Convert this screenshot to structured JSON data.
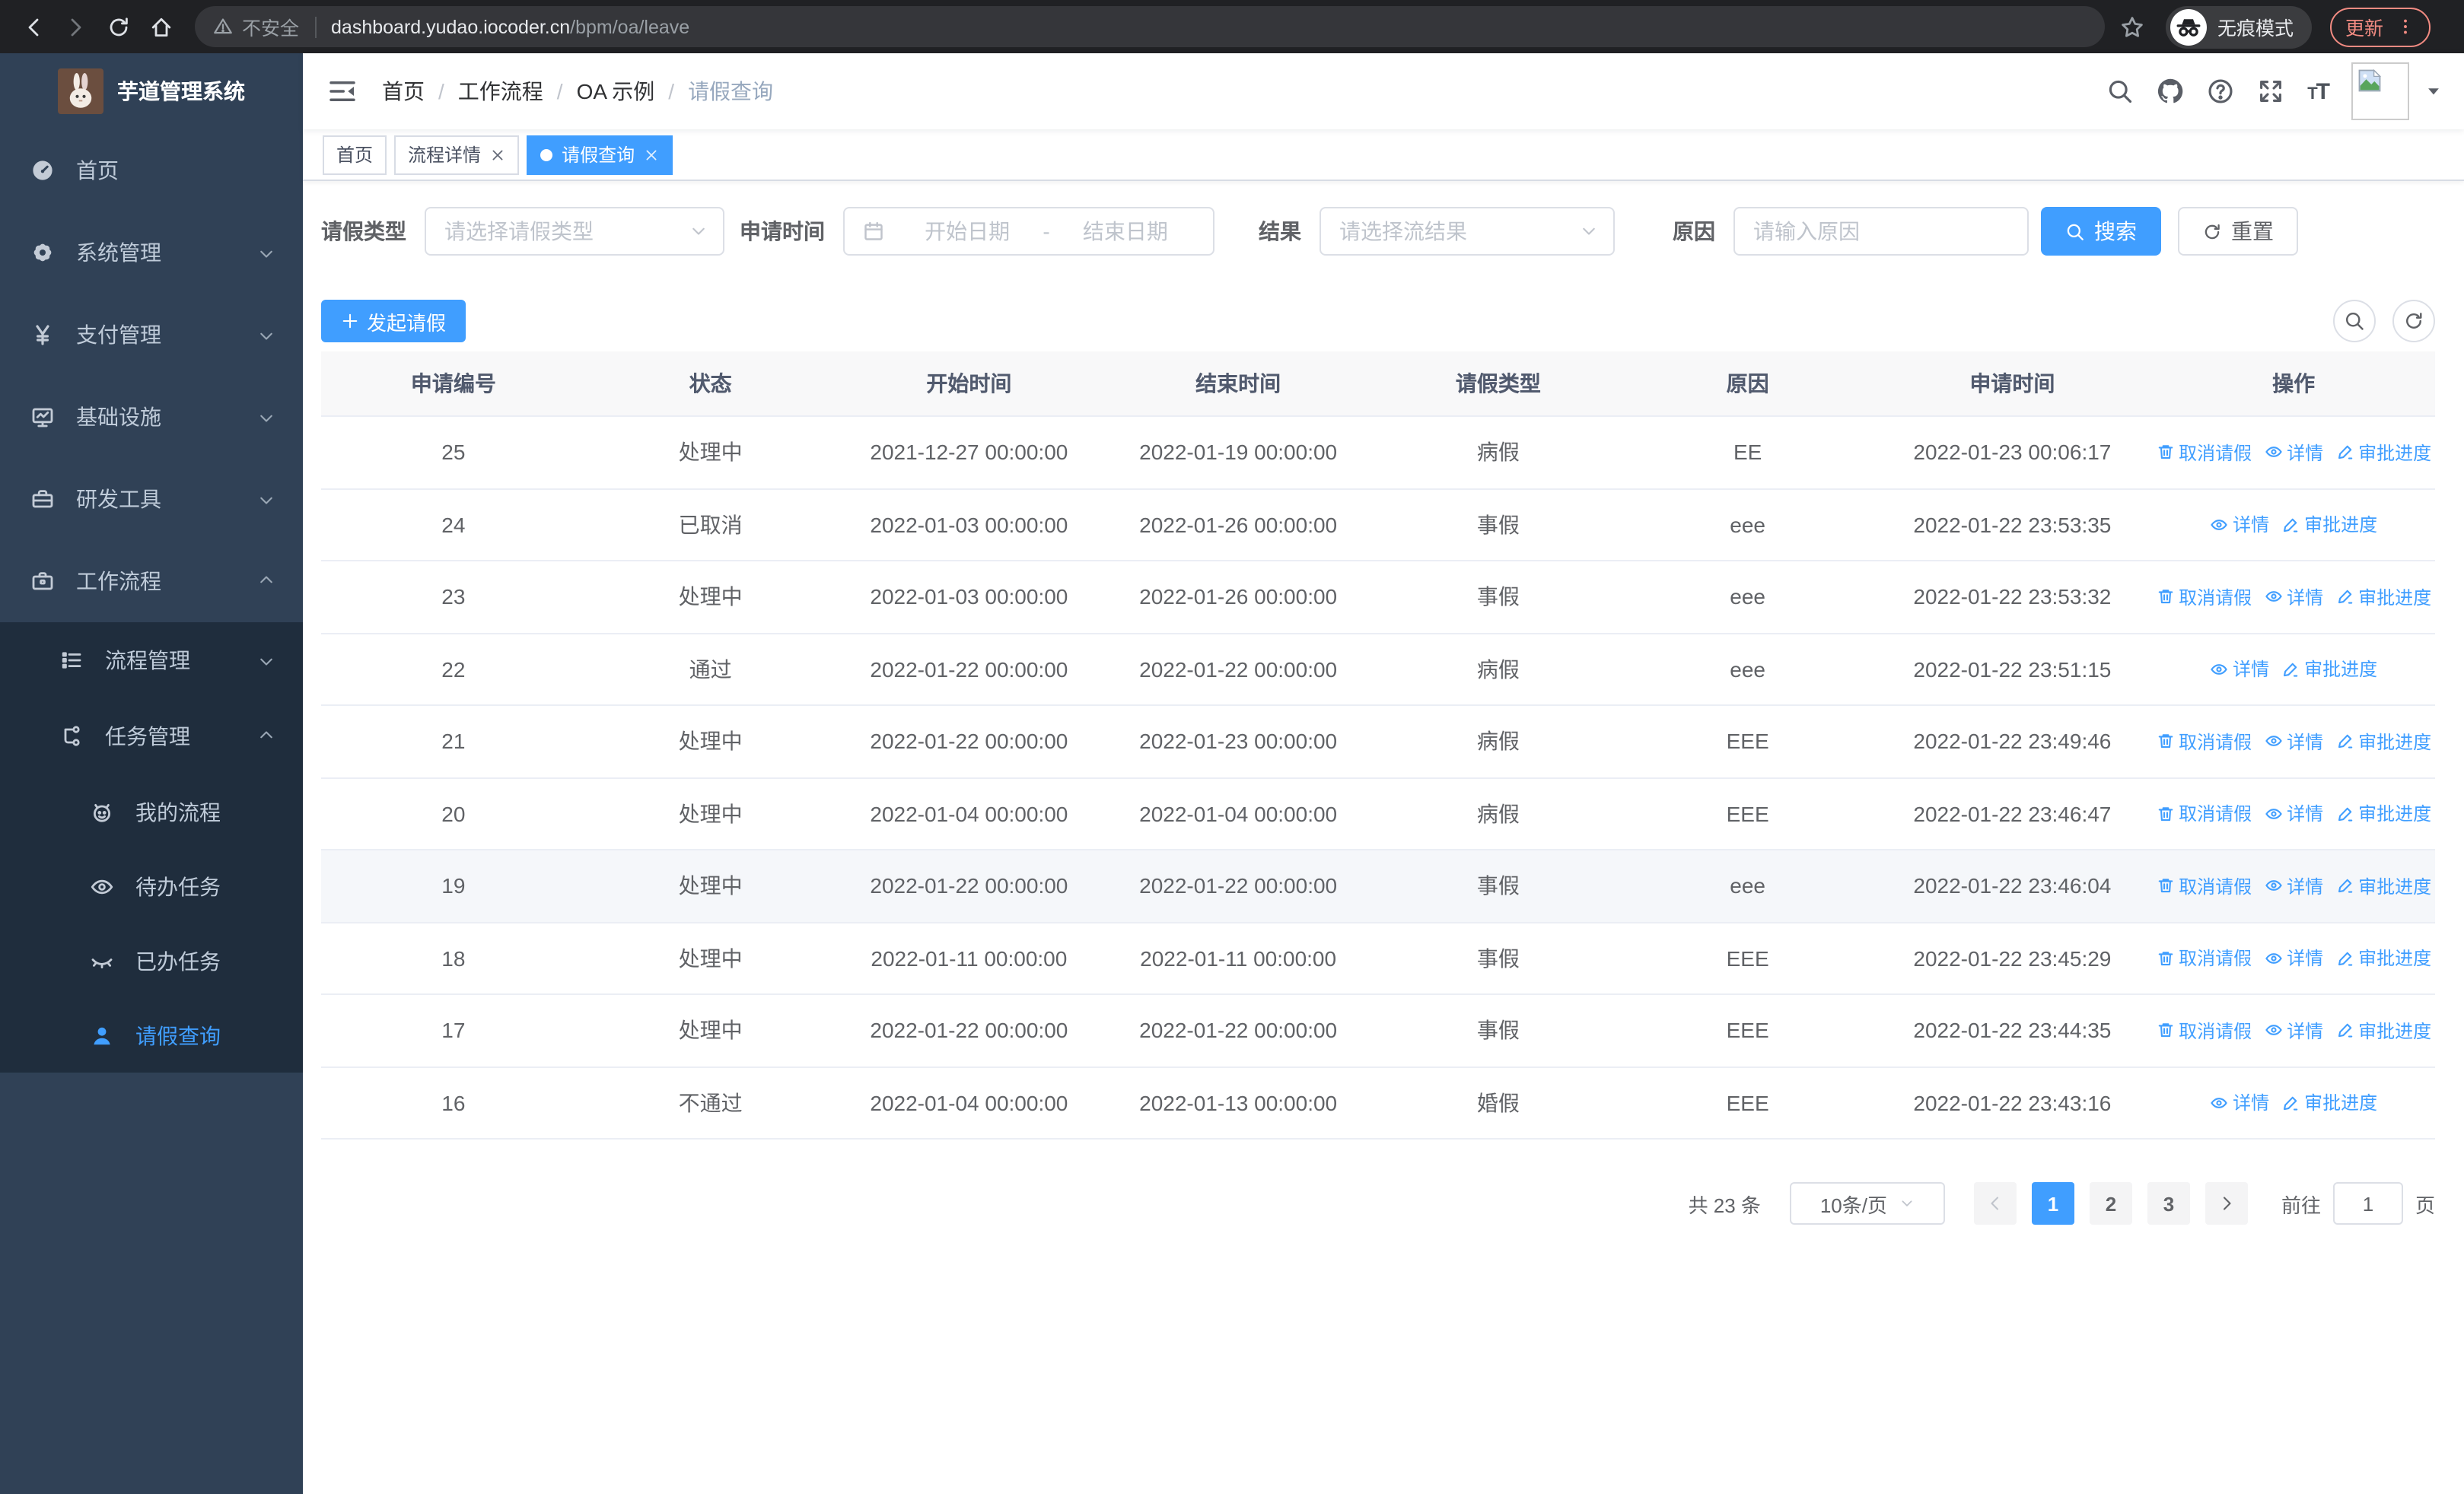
{
  "browser": {
    "security_label": "不安全",
    "url_domain": "dashboard.yudao.iocoder.cn",
    "url_path": "/bpm/oa/leave",
    "incognito_label": "无痕模式",
    "update_label": "更新"
  },
  "sidebar": {
    "title": "芋道管理系统",
    "items": [
      {
        "icon": "dashboard-icon",
        "label": "首页",
        "level": 1,
        "arrow": null,
        "sub": false,
        "active": false
      },
      {
        "icon": "gear-icon",
        "label": "系统管理",
        "level": 1,
        "arrow": "down",
        "sub": false,
        "active": false
      },
      {
        "icon": "yen-icon",
        "label": "支付管理",
        "level": 1,
        "arrow": "down",
        "sub": false,
        "active": false
      },
      {
        "icon": "monitor-icon",
        "label": "基础设施",
        "level": 1,
        "arrow": "down",
        "sub": false,
        "active": false
      },
      {
        "icon": "tools-icon",
        "label": "研发工具",
        "level": 1,
        "arrow": "down",
        "sub": false,
        "active": false
      },
      {
        "icon": "workflow-icon",
        "label": "工作流程",
        "level": 1,
        "arrow": "up",
        "sub": false,
        "active": false
      },
      {
        "icon": "list-icon",
        "label": "流程管理",
        "level": 2,
        "arrow": "down",
        "sub": true,
        "active": false
      },
      {
        "icon": "flow-icon",
        "label": "任务管理",
        "level": 2,
        "arrow": "up",
        "sub": true,
        "active": false
      },
      {
        "icon": "face-icon",
        "label": "我的流程",
        "level": 3,
        "arrow": null,
        "sub": true,
        "active": false
      },
      {
        "icon": "eye-icon",
        "label": "待办任务",
        "level": 3,
        "arrow": null,
        "sub": true,
        "active": false
      },
      {
        "icon": "eye-closed-icon",
        "label": "已办任务",
        "level": 3,
        "arrow": null,
        "sub": true,
        "active": false
      },
      {
        "icon": "user-icon",
        "label": "请假查询",
        "level": 3,
        "arrow": null,
        "sub": true,
        "active": true
      }
    ]
  },
  "header": {
    "breadcrumb": [
      "首页",
      "工作流程",
      "OA 示例",
      "请假查询"
    ],
    "separator": "/"
  },
  "tabs": [
    {
      "label": "首页"
    },
    {
      "label": "流程详情"
    },
    {
      "label": "请假查询"
    }
  ],
  "filters": {
    "leave_type": {
      "label": "请假类型",
      "placeholder": "请选择请假类型"
    },
    "apply_time": {
      "label": "申请时间",
      "start_placeholder": "开始日期",
      "separator": "-",
      "end_placeholder": "结束日期"
    },
    "result": {
      "label": "结果",
      "placeholder": "请选择流结果"
    },
    "reason": {
      "label": "原因",
      "placeholder": "请输入原因"
    },
    "search_label": "搜索",
    "reset_label": "重置"
  },
  "toolbar": {
    "create_label": "发起请假"
  },
  "table": {
    "columns": [
      "申请编号",
      "状态",
      "开始时间",
      "结束时间",
      "请假类型",
      "原因",
      "申请时间",
      "操作"
    ],
    "action_labels": {
      "cancel": "取消请假",
      "detail": "详情",
      "progress": "审批进度"
    },
    "rows": [
      {
        "id": "25",
        "status": "处理中",
        "start": "2021-12-27 00:00:00",
        "end": "2022-01-19 00:00:00",
        "type": "病假",
        "reason": "EE",
        "apply": "2022-01-23 00:06:17",
        "actions": [
          "cancel",
          "detail",
          "progress"
        ],
        "hover": false
      },
      {
        "id": "24",
        "status": "已取消",
        "start": "2022-01-03 00:00:00",
        "end": "2022-01-26 00:00:00",
        "type": "事假",
        "reason": "eee",
        "apply": "2022-01-22 23:53:35",
        "actions": [
          "detail",
          "progress"
        ],
        "hover": false
      },
      {
        "id": "23",
        "status": "处理中",
        "start": "2022-01-03 00:00:00",
        "end": "2022-01-26 00:00:00",
        "type": "事假",
        "reason": "eee",
        "apply": "2022-01-22 23:53:32",
        "actions": [
          "cancel",
          "detail",
          "progress"
        ],
        "hover": false
      },
      {
        "id": "22",
        "status": "通过",
        "start": "2022-01-22 00:00:00",
        "end": "2022-01-22 00:00:00",
        "type": "病假",
        "reason": "eee",
        "apply": "2022-01-22 23:51:15",
        "actions": [
          "detail",
          "progress"
        ],
        "hover": false
      },
      {
        "id": "21",
        "status": "处理中",
        "start": "2022-01-22 00:00:00",
        "end": "2022-01-23 00:00:00",
        "type": "病假",
        "reason": "EEE",
        "apply": "2022-01-22 23:49:46",
        "actions": [
          "cancel",
          "detail",
          "progress"
        ],
        "hover": false
      },
      {
        "id": "20",
        "status": "处理中",
        "start": "2022-01-04 00:00:00",
        "end": "2022-01-04 00:00:00",
        "type": "病假",
        "reason": "EEE",
        "apply": "2022-01-22 23:46:47",
        "actions": [
          "cancel",
          "detail",
          "progress"
        ],
        "hover": false
      },
      {
        "id": "19",
        "status": "处理中",
        "start": "2022-01-22 00:00:00",
        "end": "2022-01-22 00:00:00",
        "type": "事假",
        "reason": "eee",
        "apply": "2022-01-22 23:46:04",
        "actions": [
          "cancel",
          "detail",
          "progress"
        ],
        "hover": true
      },
      {
        "id": "18",
        "status": "处理中",
        "start": "2022-01-11 00:00:00",
        "end": "2022-01-11 00:00:00",
        "type": "事假",
        "reason": "EEE",
        "apply": "2022-01-22 23:45:29",
        "actions": [
          "cancel",
          "detail",
          "progress"
        ],
        "hover": false
      },
      {
        "id": "17",
        "status": "处理中",
        "start": "2022-01-22 00:00:00",
        "end": "2022-01-22 00:00:00",
        "type": "事假",
        "reason": "EEE",
        "apply": "2022-01-22 23:44:35",
        "actions": [
          "cancel",
          "detail",
          "progress"
        ],
        "hover": false
      },
      {
        "id": "16",
        "status": "不通过",
        "start": "2022-01-04 00:00:00",
        "end": "2022-01-13 00:00:00",
        "type": "婚假",
        "reason": "EEE",
        "apply": "2022-01-22 23:43:16",
        "actions": [
          "detail",
          "progress"
        ],
        "hover": false
      }
    ]
  },
  "pagination": {
    "total": "共 23 条",
    "page_size": "10条/页",
    "pages": [
      "1",
      "2",
      "3"
    ],
    "active_page": "1",
    "goto_label": "前往",
    "goto_value": "1",
    "page_label": "页"
  },
  "colors": {
    "primary": "#409eff",
    "link": "#409eff",
    "sidebar_bg": "#304156",
    "submenu_bg": "#1f2d3d",
    "sidebar_text": "#bfcbd9",
    "table_header_bg": "#f8f8f9",
    "row_hover_bg": "#f5f7fa",
    "border": "#ebeef5",
    "chrome_bar": "#202124",
    "update_accent": "#f28b82"
  }
}
